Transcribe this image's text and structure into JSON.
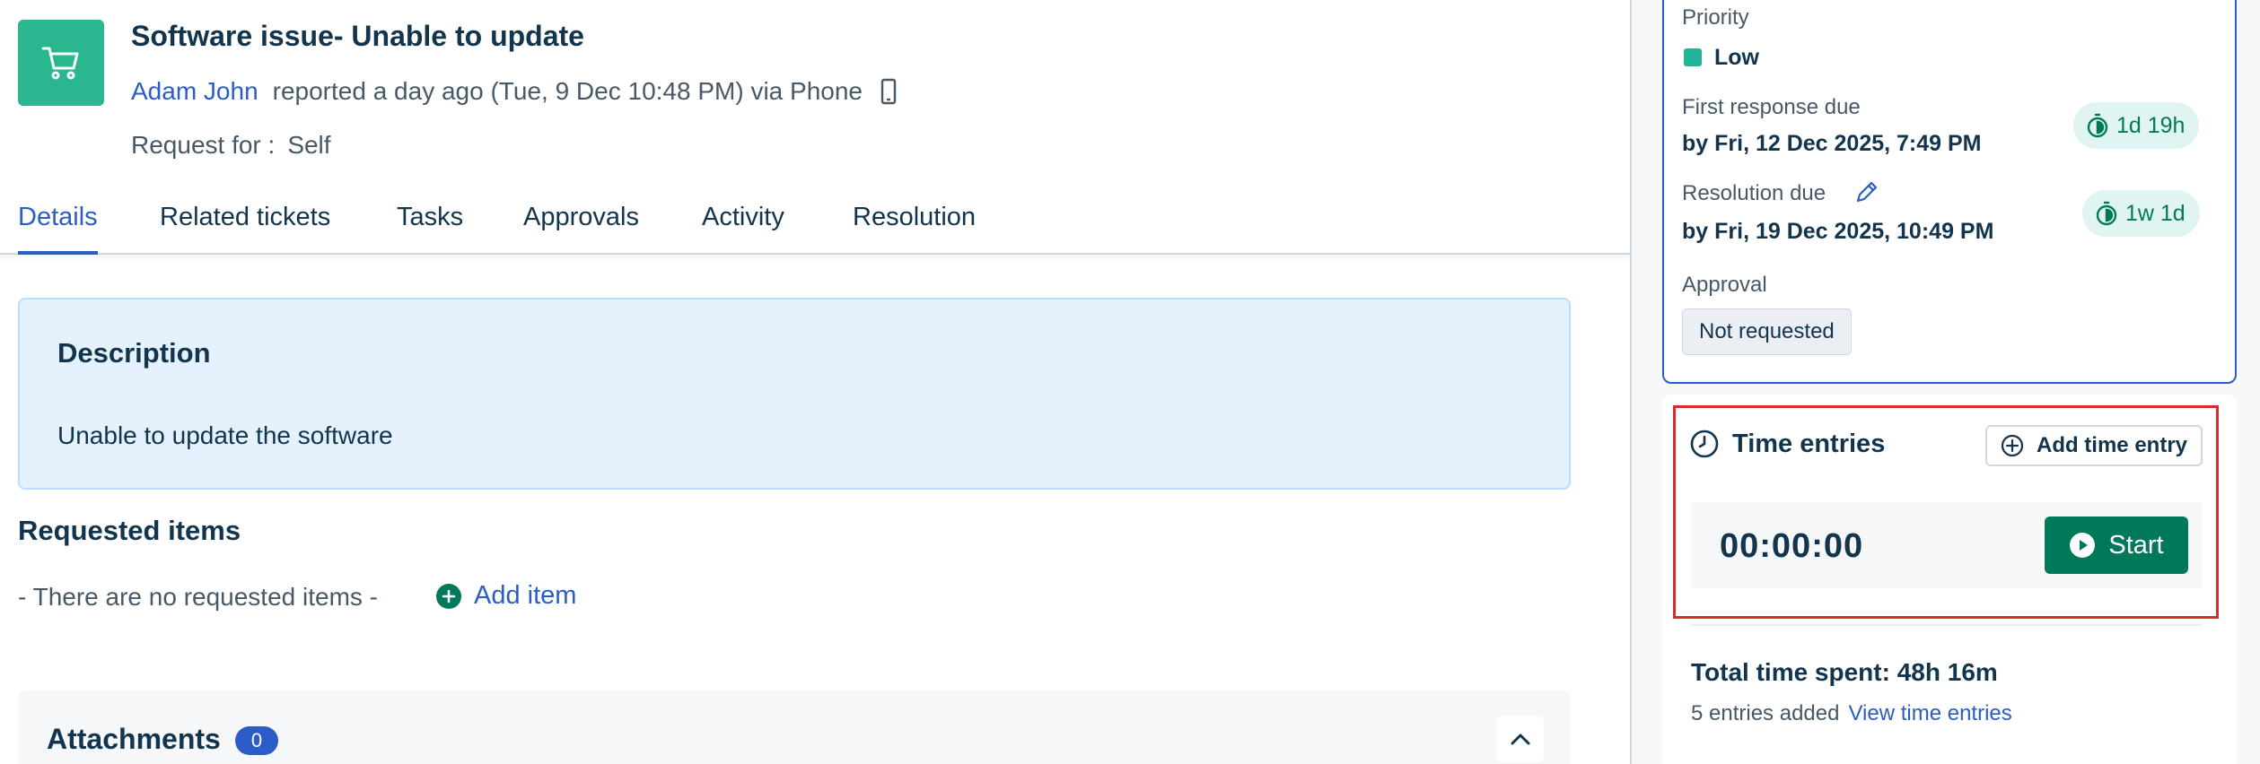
{
  "ticket": {
    "icon": "shopping-cart-icon",
    "title": "Software issue- Unable to update",
    "requester": "Adam John",
    "reported_text": "reported a day ago (Tue, 9 Dec 10:48 PM) via Phone",
    "channel_icon": "mobile-phone-icon",
    "request_for_label": "Request for :",
    "request_for_value": "Self"
  },
  "tabs": [
    {
      "label": "Details",
      "active": true
    },
    {
      "label": "Related tickets",
      "active": false
    },
    {
      "label": "Tasks",
      "active": false
    },
    {
      "label": "Approvals",
      "active": false
    },
    {
      "label": "Activity",
      "active": false
    },
    {
      "label": "Resolution",
      "active": false
    }
  ],
  "description": {
    "heading": "Description",
    "body": "Unable to update the software"
  },
  "requested_items": {
    "heading": "Requested items",
    "empty_text": "- There are no requested items -",
    "add_label": "Add item"
  },
  "attachments": {
    "label": "Attachments",
    "count": "0"
  },
  "properties": {
    "priority_label": "Priority",
    "priority_value": "Low",
    "priority_color": "#24b29a",
    "first_response_label": "First response due",
    "first_response_value": "by Fri, 12 Dec 2025, 7:49 PM",
    "first_response_badge": "1d 19h",
    "resolution_label": "Resolution due",
    "resolution_value": "by Fri, 19 Dec 2025, 10:49 PM",
    "resolution_badge": "1w 1d",
    "approval_label": "Approval",
    "approval_value": "Not requested"
  },
  "time_entries": {
    "title": "Time entries",
    "add_label": "Add time entry",
    "timer": "00:00:00",
    "start_label": "Start",
    "total_label": "Total time spent: 48h 16m",
    "entries_count": "5 entries added",
    "view_link": "View time entries"
  },
  "colors": {
    "accent": "#2c5cc5",
    "success": "#00795b",
    "ticket_icon_bg": "#2ab68e",
    "highlight": "#d72d30"
  }
}
